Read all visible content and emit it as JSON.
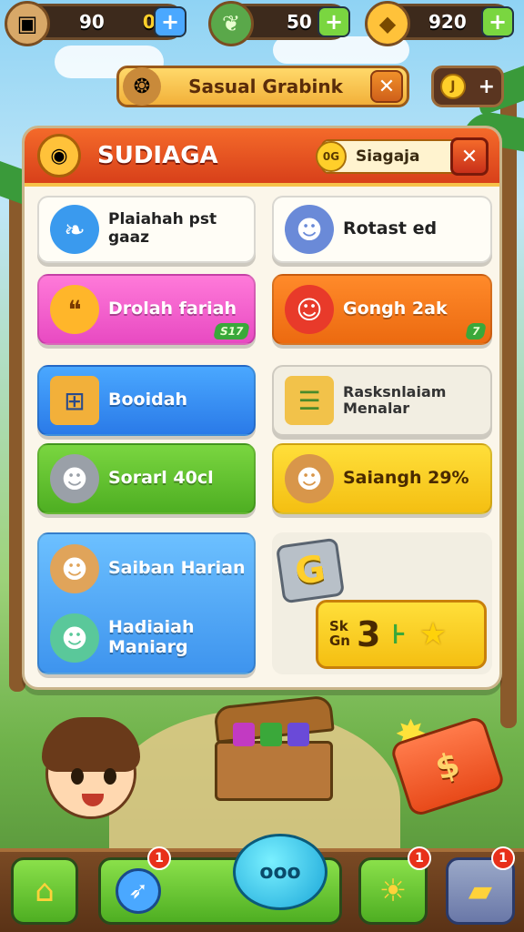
{
  "resources": [
    {
      "icon": "treasure-chest-icon",
      "value": "90",
      "extra": "0",
      "plus": "+",
      "color": "#4aa8ff"
    },
    {
      "icon": "leaf-icon",
      "value": "50",
      "plus": "+",
      "color": "#7ad640"
    },
    {
      "icon": "gold-tag-icon",
      "value": "920",
      "plus": "+",
      "color": "#7ad640"
    }
  ],
  "subbar": {
    "title": "Sasual Grabink",
    "close": "✕"
  },
  "small_button": {
    "coin": "J",
    "plus": "+"
  },
  "panel": {
    "title": "SUDIAGA",
    "badge_coin": "0G",
    "badge_text": "Siagaja",
    "close": "✕"
  },
  "cards": [
    {
      "label": "Plaiahah pst\ngaaz",
      "icon": "blue-bird-icon"
    },
    {
      "label": "Rotast ed",
      "icon": "blue-cat-icon"
    },
    {
      "label": "Drolah fariah",
      "icon": "speech-bubble-icon",
      "tag": "S17"
    },
    {
      "label": "Gongh 2ak",
      "icon": "tomato-monster-icon",
      "tag": "7"
    },
    {
      "label": "Booidah",
      "icon": "map-icon"
    },
    {
      "label": "Rasksnlaiam\nMenalar",
      "icon": "scroll-calendar-icon"
    },
    {
      "label": "Sorarl 40cl",
      "icon": "grey-cat-icon"
    },
    {
      "label": "Saiangh 29%",
      "icon": "bear-icon"
    },
    {
      "label": "Saiban Harian",
      "icon": "hamster-icon"
    },
    {
      "label": "Hadiaiah\nManiarg",
      "icon": "green-pig-icon"
    }
  ],
  "reward_box": {
    "g_letter": "G",
    "small": "Sk\nGn",
    "big": "3",
    "bar": "⊦",
    "star": "★"
  },
  "nav": {
    "badge1": "1",
    "badge2": "1",
    "badge3": "1",
    "bubble_text": "ooo"
  },
  "redcard_symbol": "$",
  "colors": {
    "header": "#e8501a",
    "panel": "#fbf6ea",
    "nav": "#6a3e1c"
  }
}
